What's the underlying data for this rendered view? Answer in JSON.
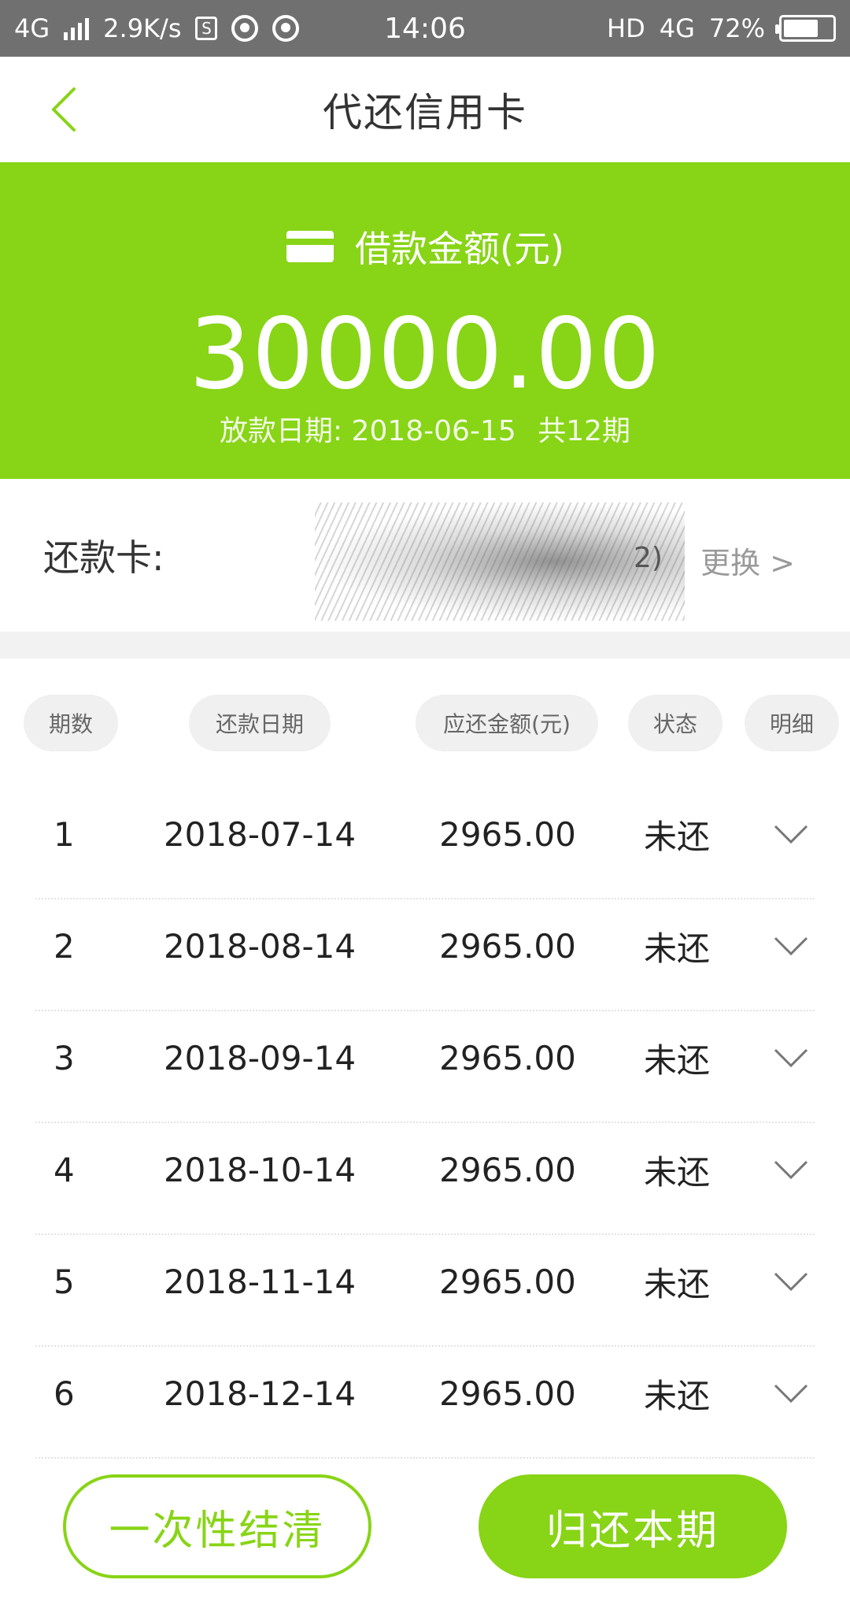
{
  "status_bar": {
    "network": "4G",
    "speed": "2.9K/s",
    "s_badge": "S",
    "time": "14:06",
    "hd": "HD",
    "network_right": "4G",
    "battery": "72%",
    "battery_level": 0.72
  },
  "nav": {
    "title": "代还信用卡",
    "back_icon": "chevron-left-icon"
  },
  "hero": {
    "label": "借款金额(元)",
    "card_icon": "credit-card-icon",
    "amount": "30000.00",
    "loan_date": "放款日期: 2018-06-15",
    "periods": "共12期"
  },
  "repay_card": {
    "label": "还款卡:",
    "suffix": "2)",
    "change_label": "更换 >"
  },
  "table": {
    "headers": [
      "期数",
      "还款日期",
      "应还金额(元)",
      "状态",
      "明细"
    ],
    "rows": [
      {
        "no": "1",
        "date": "2018-07-14",
        "amount": "2965.00",
        "status": "未还"
      },
      {
        "no": "2",
        "date": "2018-08-14",
        "amount": "2965.00",
        "status": "未还"
      },
      {
        "no": "3",
        "date": "2018-09-14",
        "amount": "2965.00",
        "status": "未还"
      },
      {
        "no": "4",
        "date": "2018-10-14",
        "amount": "2965.00",
        "status": "未还"
      },
      {
        "no": "5",
        "date": "2018-11-14",
        "amount": "2965.00",
        "status": "未还"
      },
      {
        "no": "6",
        "date": "2018-12-14",
        "amount": "2965.00",
        "status": "未还"
      }
    ]
  },
  "actions": {
    "settle_all": "一次性结清",
    "repay_current": "归还本期"
  },
  "colors": {
    "accent": "#88d416",
    "status_bar": "#707070"
  }
}
